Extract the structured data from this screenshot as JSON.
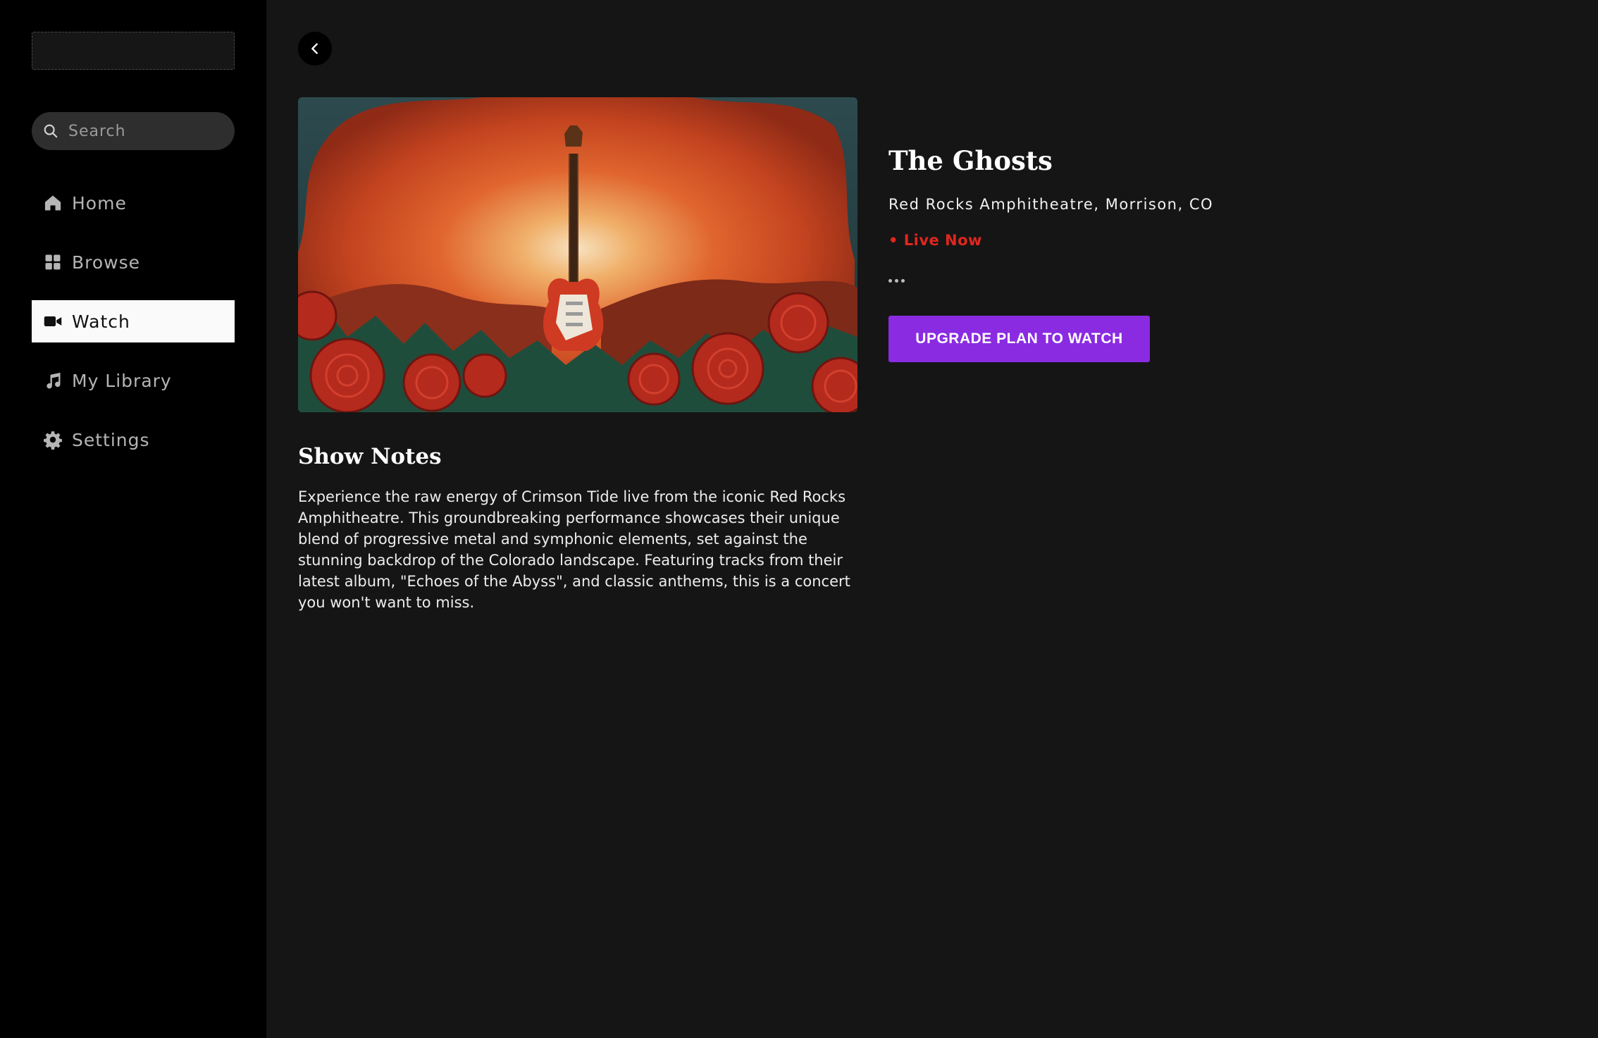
{
  "sidebar": {
    "search": {
      "placeholder": "Search"
    },
    "nav": [
      {
        "label": "Home",
        "icon": "home-icon"
      },
      {
        "label": "Browse",
        "icon": "grid-icon"
      },
      {
        "label": "Watch",
        "icon": "video-camera-icon",
        "active": true
      },
      {
        "label": "My Library",
        "icon": "music-note-icon"
      },
      {
        "label": "Settings",
        "icon": "gear-icon"
      }
    ]
  },
  "main": {
    "back_icon": "chevron-left-icon",
    "event": {
      "title": "The Ghosts",
      "venue": "Red Rocks Amphitheatre, Morrison, CO",
      "status": "• Live Now",
      "more_icon": "more-horizontal-icon",
      "cta_label": "UPGRADE PLAN TO WATCH"
    },
    "show_notes": {
      "heading": "Show Notes",
      "body": "Experience the raw energy of Crimson Tide live from the iconic Red Rocks Amphitheatre. This groundbreaking performance showcases their unique blend of progressive metal and symphonic elements, set against the stunning backdrop of the Colorado landscape. Featuring tracks from their latest album, \"Echoes of the Abyss\", and classic anthems, this is a concert you won't want to miss."
    }
  },
  "colors": {
    "background": "#151515",
    "sidebar": "#000000",
    "accent": "#8a2be2",
    "live": "#e0261e",
    "active_nav": "#fafafa"
  }
}
